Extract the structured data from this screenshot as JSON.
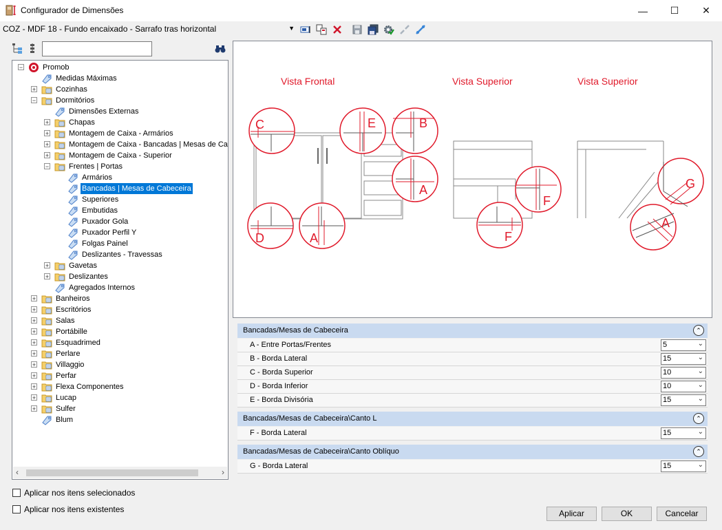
{
  "window": {
    "title": "Configurador de Dimensões"
  },
  "toolbar": {
    "config_selector": "COZ - MDF 18 - Fundo encaixado - Sarrafo tras horizontal"
  },
  "tree": {
    "nodes": [
      {
        "label": "Promob",
        "level": 0,
        "expander": "minus",
        "icon": "promob-logo-icon"
      },
      {
        "label": "Medidas Máximas",
        "level": 1,
        "expander": "none",
        "icon": "tag-icon"
      },
      {
        "label": "Cozinhas",
        "level": 1,
        "expander": "plus",
        "icon": "folder-icon"
      },
      {
        "label": "Dormitórios",
        "level": 1,
        "expander": "minus",
        "icon": "folder-icon"
      },
      {
        "label": "Dimensões Externas",
        "level": 2,
        "expander": "none",
        "icon": "tag-icon"
      },
      {
        "label": "Chapas",
        "level": 2,
        "expander": "plus",
        "icon": "folder-icon"
      },
      {
        "label": "Montagem de Caixa - Armários",
        "level": 2,
        "expander": "plus",
        "icon": "folder-icon"
      },
      {
        "label": "Montagem de Caixa - Bancadas | Mesas de Cabeceira",
        "level": 2,
        "expander": "plus",
        "icon": "folder-icon"
      },
      {
        "label": "Montagem de Caixa - Superior",
        "level": 2,
        "expander": "plus",
        "icon": "folder-icon"
      },
      {
        "label": "Frentes | Portas",
        "level": 2,
        "expander": "minus",
        "icon": "folder-icon"
      },
      {
        "label": "Armários",
        "level": 3,
        "expander": "none",
        "icon": "tag-icon"
      },
      {
        "label": "Bancadas | Mesas de Cabeceira",
        "level": 3,
        "expander": "none",
        "icon": "tag-icon",
        "selected": true
      },
      {
        "label": "Superiores",
        "level": 3,
        "expander": "none",
        "icon": "tag-icon"
      },
      {
        "label": "Embutidas",
        "level": 3,
        "expander": "none",
        "icon": "tag-icon"
      },
      {
        "label": "Puxador Gola",
        "level": 3,
        "expander": "none",
        "icon": "tag-icon"
      },
      {
        "label": "Puxador Perfil Y",
        "level": 3,
        "expander": "none",
        "icon": "tag-icon"
      },
      {
        "label": "Folgas Painel",
        "level": 3,
        "expander": "none",
        "icon": "tag-icon"
      },
      {
        "label": "Deslizantes - Travessas",
        "level": 3,
        "expander": "none",
        "icon": "tag-icon"
      },
      {
        "label": "Gavetas",
        "level": 2,
        "expander": "plus",
        "icon": "folder-icon"
      },
      {
        "label": "Deslizantes",
        "level": 2,
        "expander": "plus",
        "icon": "folder-icon"
      },
      {
        "label": "Agregados Internos",
        "level": 2,
        "expander": "none",
        "icon": "tag-icon"
      },
      {
        "label": "Banheiros",
        "level": 1,
        "expander": "plus",
        "icon": "folder-icon"
      },
      {
        "label": "Escritórios",
        "level": 1,
        "expander": "plus",
        "icon": "folder-icon"
      },
      {
        "label": "Salas",
        "level": 1,
        "expander": "plus",
        "icon": "folder-icon"
      },
      {
        "label": "Portábille",
        "level": 1,
        "expander": "plus",
        "icon": "folder-icon"
      },
      {
        "label": "Esquadrimed",
        "level": 1,
        "expander": "plus",
        "icon": "folder-icon"
      },
      {
        "label": "Perlare",
        "level": 1,
        "expander": "plus",
        "icon": "folder-icon"
      },
      {
        "label": "Villaggio",
        "level": 1,
        "expander": "plus",
        "icon": "folder-icon"
      },
      {
        "label": "Perfar",
        "level": 1,
        "expander": "plus",
        "icon": "folder-icon"
      },
      {
        "label": "Flexa Componentes",
        "level": 1,
        "expander": "plus",
        "icon": "folder-icon"
      },
      {
        "label": "Lucap",
        "level": 1,
        "expander": "plus",
        "icon": "folder-icon"
      },
      {
        "label": "Sulfer",
        "level": 1,
        "expander": "plus",
        "icon": "folder-icon"
      },
      {
        "label": "Blum",
        "level": 1,
        "expander": "none",
        "icon": "tag-icon"
      }
    ]
  },
  "preview": {
    "vista_frontal": "Vista Frontal",
    "vista_superior_1": "Vista Superior",
    "vista_superior_2": "Vista Superior",
    "markers": {
      "a": "A",
      "b": "B",
      "c": "C",
      "d": "D",
      "e": "E",
      "f": "F",
      "g": "G"
    },
    "accent_color": "#e0192a"
  },
  "groups": [
    {
      "title": "Bancadas/Mesas de Cabeceira",
      "rows": [
        {
          "label": "A - Entre Portas/Frentes",
          "value": "5"
        },
        {
          "label": "B - Borda Lateral",
          "value": "15"
        },
        {
          "label": "C - Borda Superior",
          "value": "10"
        },
        {
          "label": "D - Borda Inferior",
          "value": "10"
        },
        {
          "label": "E - Borda Divisória",
          "value": "15"
        }
      ]
    },
    {
      "title": "Bancadas/Mesas de Cabeceira\\Canto L",
      "rows": [
        {
          "label": "F - Borda Lateral",
          "value": "15"
        }
      ]
    },
    {
      "title": "Bancadas/Mesas de Cabeceira\\Canto Oblíquo",
      "rows": [
        {
          "label": "G - Borda Lateral",
          "value": "15"
        }
      ]
    }
  ],
  "options": {
    "apply_selected": "Aplicar nos itens selecionados",
    "apply_existing": "Aplicar nos itens existentes"
  },
  "buttons": {
    "apply": "Aplicar",
    "ok": "OK",
    "cancel": "Cancelar"
  }
}
